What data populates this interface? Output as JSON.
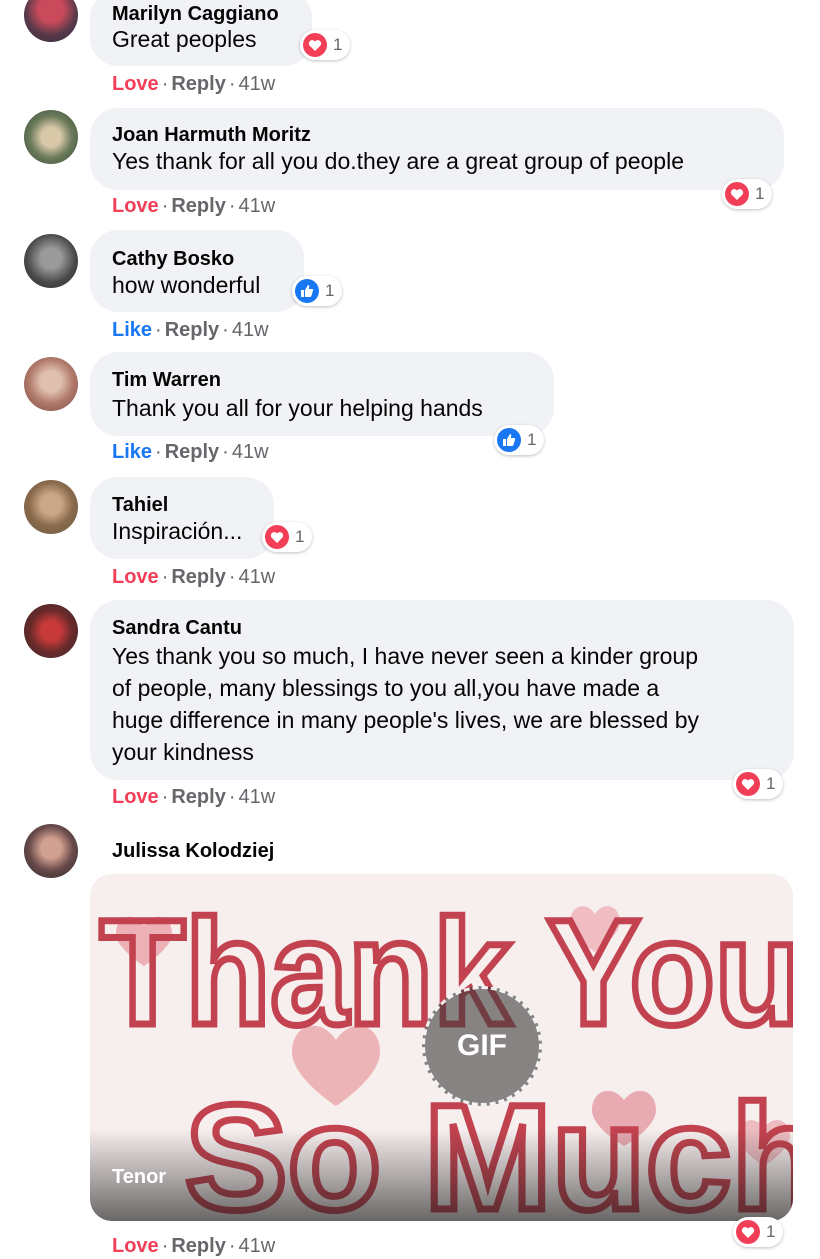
{
  "comments": [
    {
      "name": "Marilyn Caggiano",
      "text": [
        "Great peoples"
      ],
      "action": "Love",
      "reply": "Reply",
      "time": "41w",
      "reaction": {
        "type": "heart",
        "count": "1"
      }
    },
    {
      "name": "Joan Harmuth Moritz",
      "text": [
        "Yes thank for all you do.they are a great group of people"
      ],
      "action": "Love",
      "reply": "Reply",
      "time": "41w",
      "reaction": {
        "type": "heart",
        "count": "1"
      }
    },
    {
      "name": "Cathy Bosko",
      "text": [
        "how wonderful"
      ],
      "action": "Like",
      "reply": "Reply",
      "time": "41w",
      "reaction": {
        "type": "thumb",
        "count": "1"
      }
    },
    {
      "name": "Tim Warren",
      "text": [
        "Thank you all for your helping hands"
      ],
      "action": "Like",
      "reply": "Reply",
      "time": "41w",
      "reaction": {
        "type": "thumb",
        "count": "1"
      }
    },
    {
      "name": "Tahiel",
      "text": [
        "Inspiración..."
      ],
      "action": "Love",
      "reply": "Reply",
      "time": "41w",
      "reaction": {
        "type": "heart",
        "count": "1"
      }
    },
    {
      "name": "Sandra Cantu",
      "text": [
        "Yes thank you so much, I have never seen a kinder group",
        "of people, many blessings to you all,you have made a",
        "huge difference in many people's lives, we are blessed by",
        "your kindness"
      ],
      "action": "Love",
      "reply": "Reply",
      "time": "41w",
      "reaction": {
        "type": "heart",
        "count": "1"
      }
    },
    {
      "name": "Julissa Kolodziej",
      "gif": {
        "line1": "Thank You",
        "line2": "So Much",
        "badge": "GIF",
        "provider": "Tenor"
      },
      "action": "Love",
      "reply": "Reply",
      "time": "41w",
      "reaction": {
        "type": "heart",
        "count": "1"
      }
    }
  ],
  "colors": {
    "love": "#f33e58",
    "like": "#1877f2",
    "bubble": "#f0f2f5",
    "meta": "#65676b"
  },
  "separator": "·"
}
